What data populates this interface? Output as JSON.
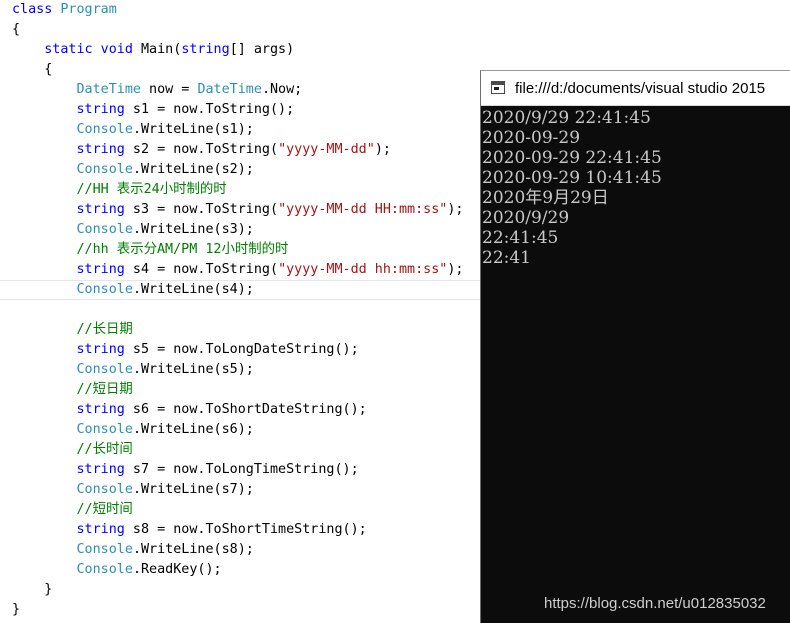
{
  "editor": {
    "lines": [
      [
        {
          "t": "class ",
          "c": "kw"
        },
        {
          "t": "Program",
          "c": "ty"
        }
      ],
      [
        {
          "t": "{",
          "c": "pl"
        }
      ],
      [
        {
          "t": "    ",
          "c": "pl"
        },
        {
          "t": "static void ",
          "c": "kw"
        },
        {
          "t": "Main(",
          "c": "pl"
        },
        {
          "t": "string",
          "c": "kw"
        },
        {
          "t": "[] args)",
          "c": "pl"
        }
      ],
      [
        {
          "t": "    {",
          "c": "pl"
        }
      ],
      [
        {
          "t": "        ",
          "c": "pl"
        },
        {
          "t": "DateTime",
          "c": "ty"
        },
        {
          "t": " now = ",
          "c": "pl"
        },
        {
          "t": "DateTime",
          "c": "ty"
        },
        {
          "t": ".Now;",
          "c": "pl"
        }
      ],
      [
        {
          "t": "        ",
          "c": "pl"
        },
        {
          "t": "string",
          "c": "kw"
        },
        {
          "t": " s1 = now.ToString();",
          "c": "pl"
        }
      ],
      [
        {
          "t": "        ",
          "c": "pl"
        },
        {
          "t": "Console",
          "c": "ty"
        },
        {
          "t": ".WriteLine(s1);",
          "c": "pl"
        }
      ],
      [
        {
          "t": "        ",
          "c": "pl"
        },
        {
          "t": "string",
          "c": "kw"
        },
        {
          "t": " s2 = now.ToString(",
          "c": "pl"
        },
        {
          "t": "\"yyyy-MM-dd\"",
          "c": "str"
        },
        {
          "t": ");",
          "c": "pl"
        }
      ],
      [
        {
          "t": "        ",
          "c": "pl"
        },
        {
          "t": "Console",
          "c": "ty"
        },
        {
          "t": ".WriteLine(s2);",
          "c": "pl"
        }
      ],
      [
        {
          "t": "        ",
          "c": "pl"
        },
        {
          "t": "//HH 表示24小时制的时",
          "c": "cm"
        }
      ],
      [
        {
          "t": "        ",
          "c": "pl"
        },
        {
          "t": "string",
          "c": "kw"
        },
        {
          "t": " s3 = now.ToString(",
          "c": "pl"
        },
        {
          "t": "\"yyyy-MM-dd HH:mm:ss\"",
          "c": "str"
        },
        {
          "t": ");",
          "c": "pl"
        }
      ],
      [
        {
          "t": "        ",
          "c": "pl"
        },
        {
          "t": "Console",
          "c": "ty"
        },
        {
          "t": ".WriteLine(s3);",
          "c": "pl"
        }
      ],
      [
        {
          "t": "        ",
          "c": "pl"
        },
        {
          "t": "//hh 表示分AM/PM 12小时制的时",
          "c": "cm"
        }
      ],
      [
        {
          "t": "        ",
          "c": "pl"
        },
        {
          "t": "string",
          "c": "kw"
        },
        {
          "t": " s4 = now.ToString(",
          "c": "pl"
        },
        {
          "t": "\"yyyy-MM-dd hh:mm:ss\"",
          "c": "str"
        },
        {
          "t": ");",
          "c": "pl"
        }
      ],
      [
        {
          "t": "        ",
          "c": "pl"
        },
        {
          "t": "Console",
          "c": "ty"
        },
        {
          "t": ".WriteLine(s4);",
          "c": "pl"
        }
      ],
      [],
      [
        {
          "t": "        ",
          "c": "pl"
        },
        {
          "t": "//长日期",
          "c": "cm"
        }
      ],
      [
        {
          "t": "        ",
          "c": "pl"
        },
        {
          "t": "string",
          "c": "kw"
        },
        {
          "t": " s5 = now.ToLongDateString();",
          "c": "pl"
        }
      ],
      [
        {
          "t": "        ",
          "c": "pl"
        },
        {
          "t": "Console",
          "c": "ty"
        },
        {
          "t": ".WriteLine(s5);",
          "c": "pl"
        }
      ],
      [
        {
          "t": "        ",
          "c": "pl"
        },
        {
          "t": "//短日期",
          "c": "cm"
        }
      ],
      [
        {
          "t": "        ",
          "c": "pl"
        },
        {
          "t": "string",
          "c": "kw"
        },
        {
          "t": " s6 = now.ToShortDateString();",
          "c": "pl"
        }
      ],
      [
        {
          "t": "        ",
          "c": "pl"
        },
        {
          "t": "Console",
          "c": "ty"
        },
        {
          "t": ".WriteLine(s6);",
          "c": "pl"
        }
      ],
      [
        {
          "t": "        ",
          "c": "pl"
        },
        {
          "t": "//长时间",
          "c": "cm"
        }
      ],
      [
        {
          "t": "        ",
          "c": "pl"
        },
        {
          "t": "string",
          "c": "kw"
        },
        {
          "t": " s7 = now.ToLongTimeString();",
          "c": "pl"
        }
      ],
      [
        {
          "t": "        ",
          "c": "pl"
        },
        {
          "t": "Console",
          "c": "ty"
        },
        {
          "t": ".WriteLine(s7);",
          "c": "pl"
        }
      ],
      [
        {
          "t": "        ",
          "c": "pl"
        },
        {
          "t": "//短时间",
          "c": "cm"
        }
      ],
      [
        {
          "t": "        ",
          "c": "pl"
        },
        {
          "t": "string",
          "c": "kw"
        },
        {
          "t": " s8 = now.ToShortTimeString();",
          "c": "pl"
        }
      ],
      [
        {
          "t": "        ",
          "c": "pl"
        },
        {
          "t": "Console",
          "c": "ty"
        },
        {
          "t": ".WriteLine(s8);",
          "c": "pl"
        }
      ],
      [
        {
          "t": "        ",
          "c": "pl"
        },
        {
          "t": "Console",
          "c": "ty"
        },
        {
          "t": ".ReadKey();",
          "c": "pl"
        }
      ],
      [
        {
          "t": "    }",
          "c": "pl"
        }
      ],
      [
        {
          "t": "}",
          "c": "pl"
        }
      ]
    ],
    "current_line_index": 14
  },
  "console": {
    "title": "file:///d:/documents/visual studio 2015",
    "icon": "console-window-icon",
    "output": [
      "2020/9/29 22:41:45",
      "2020-09-29",
      "2020-09-29 22:41:45",
      "2020-09-29 10:41:45",
      "2020年9月29日",
      "2020/9/29",
      "22:41:45",
      "22:41"
    ]
  },
  "watermark": "https://blog.csdn.net/u012835032",
  "colors": {
    "keyword": "#0000ff",
    "type": "#2b91af",
    "string": "#a31515",
    "comment": "#008000",
    "console_bg": "#0c0c0c",
    "console_text": "#c8c8c8"
  }
}
